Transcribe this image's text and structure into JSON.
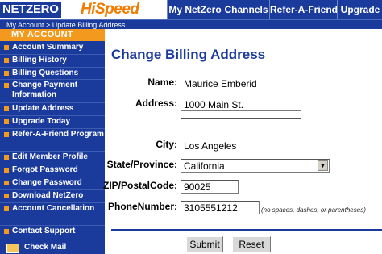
{
  "brand": {
    "name_left": "NETZERO",
    "name_right": "HiSpeed"
  },
  "nav": {
    "tabs": [
      "My NetZero",
      "Channels",
      "Refer-A-Friend",
      "Upgrade"
    ]
  },
  "breadcrumb": "My Account > Update Billing Address",
  "sidebar": {
    "heading": "MY ACCOUNT",
    "items": [
      "Account Summary",
      "Billing History",
      "Billing Questions",
      "Change Payment Information",
      "Update Address",
      "Upgrade Today",
      "Refer-A-Friend Program",
      "Edit Member Profile",
      "Forgot Password",
      "Change Password",
      "Download NetZero",
      "Account Cancellation",
      "Contact Support"
    ],
    "check_mail": "Check Mail"
  },
  "form": {
    "title": "Change Billing Address",
    "name_label": "Name:",
    "name_value": "Maurice Emberid",
    "address_label": "Address:",
    "address1_value": "1000 Main St.",
    "address2_value": "",
    "city_label": "City:",
    "city_value": "Los Angeles",
    "state_label": "State/Province:",
    "state_value": "California",
    "zip_label": "ZIP/PostalCode:",
    "zip_value": "90025",
    "phone_label": "PhoneNumber:",
    "phone_value": "3105551212",
    "phone_hint": "(no spaces, dashes, or parentheses)",
    "submit_label": "Submit",
    "reset_label": "Reset"
  },
  "colors": {
    "brand_blue": "#1a3b9c",
    "accent_orange": "#f39a1e",
    "hispeed_orange": "#f07d00"
  }
}
